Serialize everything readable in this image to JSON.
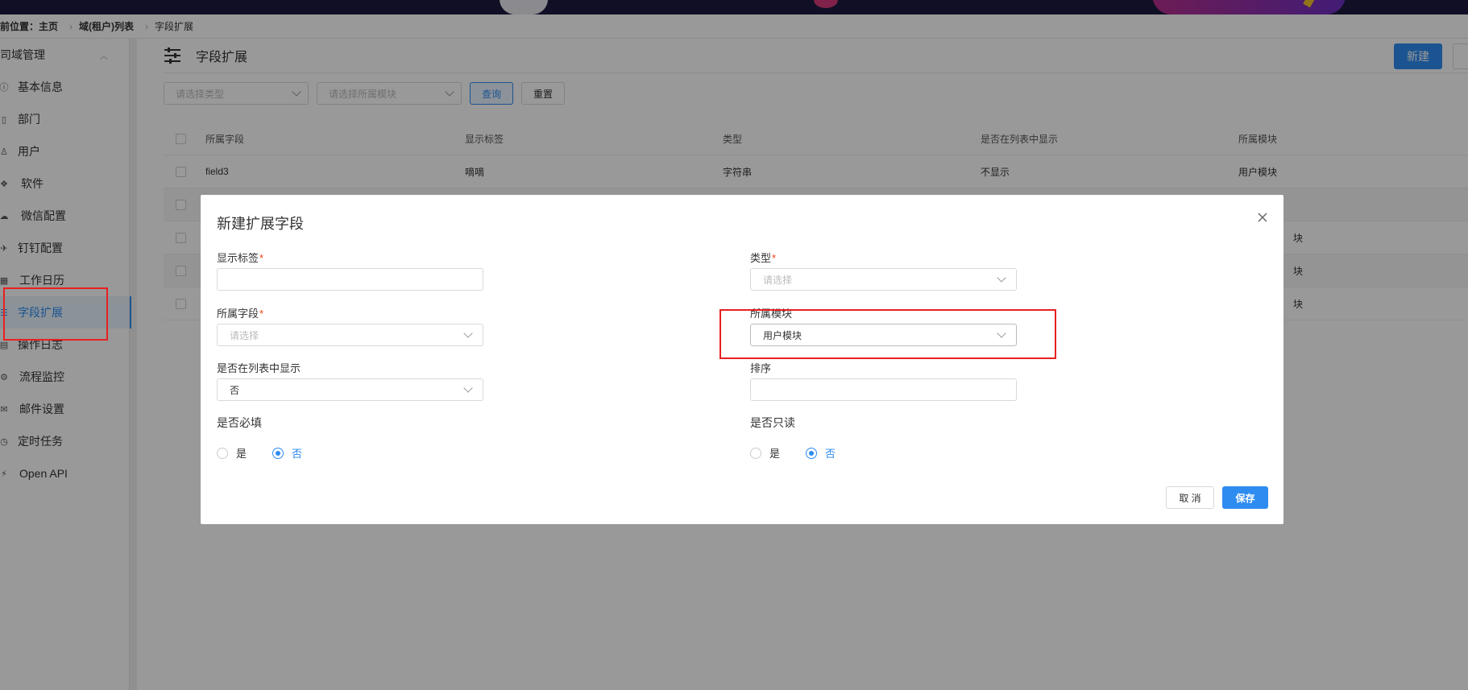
{
  "breadcrumb": {
    "prefix": "前位置：主页",
    "level2": "域(租户)列表",
    "current": "字段扩展"
  },
  "sidebar": {
    "group_label": "司域管理",
    "items": [
      {
        "label": "基本信息",
        "icon": "info-icon"
      },
      {
        "label": "部门",
        "icon": "building-icon"
      },
      {
        "label": "用户",
        "icon": "user-icon"
      },
      {
        "label": "软件",
        "icon": "cubes-icon"
      },
      {
        "label": "微信配置",
        "icon": "wechat-icon"
      },
      {
        "label": "钉钉配置",
        "icon": "dingtalk-icon"
      },
      {
        "label": "工作日历",
        "icon": "calendar-icon"
      },
      {
        "label": "字段扩展",
        "icon": "sliders-icon",
        "active": true
      },
      {
        "label": "操作日志",
        "icon": "log-icon"
      },
      {
        "label": "流程监控",
        "icon": "flow-icon"
      },
      {
        "label": "邮件设置",
        "icon": "mail-icon"
      },
      {
        "label": "定时任务",
        "icon": "clock-icon"
      },
      {
        "label": "Open API",
        "icon": "plug-icon"
      }
    ]
  },
  "main": {
    "title": "字段扩展",
    "new_button": "新建",
    "filter": {
      "type_placeholder": "请选择类型",
      "module_placeholder": "请选择所属模块",
      "query_button": "查询",
      "reset_button": "重置"
    },
    "table": {
      "columns": [
        "所属字段",
        "显示标签",
        "类型",
        "是否在列表中显示",
        "所属模块"
      ],
      "rows": [
        [
          "field3",
          "嘀嘀",
          "字符串",
          "不显示",
          "用户模块"
        ],
        [
          "",
          "",
          "",
          "",
          ""
        ],
        [
          "",
          "",
          "",
          "",
          "块"
        ],
        [
          "",
          "",
          "",
          "",
          "块"
        ],
        [
          "",
          "",
          "",
          "",
          "块"
        ]
      ]
    }
  },
  "dialog": {
    "title": "新建扩展字段",
    "fields": {
      "display_label": {
        "label": "显示标签",
        "required": "*",
        "value": ""
      },
      "type": {
        "label": "类型",
        "required": "*",
        "placeholder": "请选择"
      },
      "field": {
        "label": "所属字段",
        "required": "*",
        "placeholder": "请选择"
      },
      "module": {
        "label": "所属模块",
        "value": "用户模块"
      },
      "show_in_list": {
        "label": "是否在列表中显示",
        "value": "否"
      },
      "sort": {
        "label": "排序",
        "value": ""
      },
      "required_flag": {
        "label": "是否必填",
        "options": [
          "是",
          "否"
        ],
        "selected": "否"
      },
      "readonly_flag": {
        "label": "是否只读",
        "options": [
          "是",
          "否"
        ],
        "selected": "否"
      }
    },
    "cancel_button": "取 消",
    "save_button": "保存"
  },
  "colors": {
    "primary": "#2e8cf0",
    "highlight": "#e8201f",
    "required": "#ed4014"
  }
}
